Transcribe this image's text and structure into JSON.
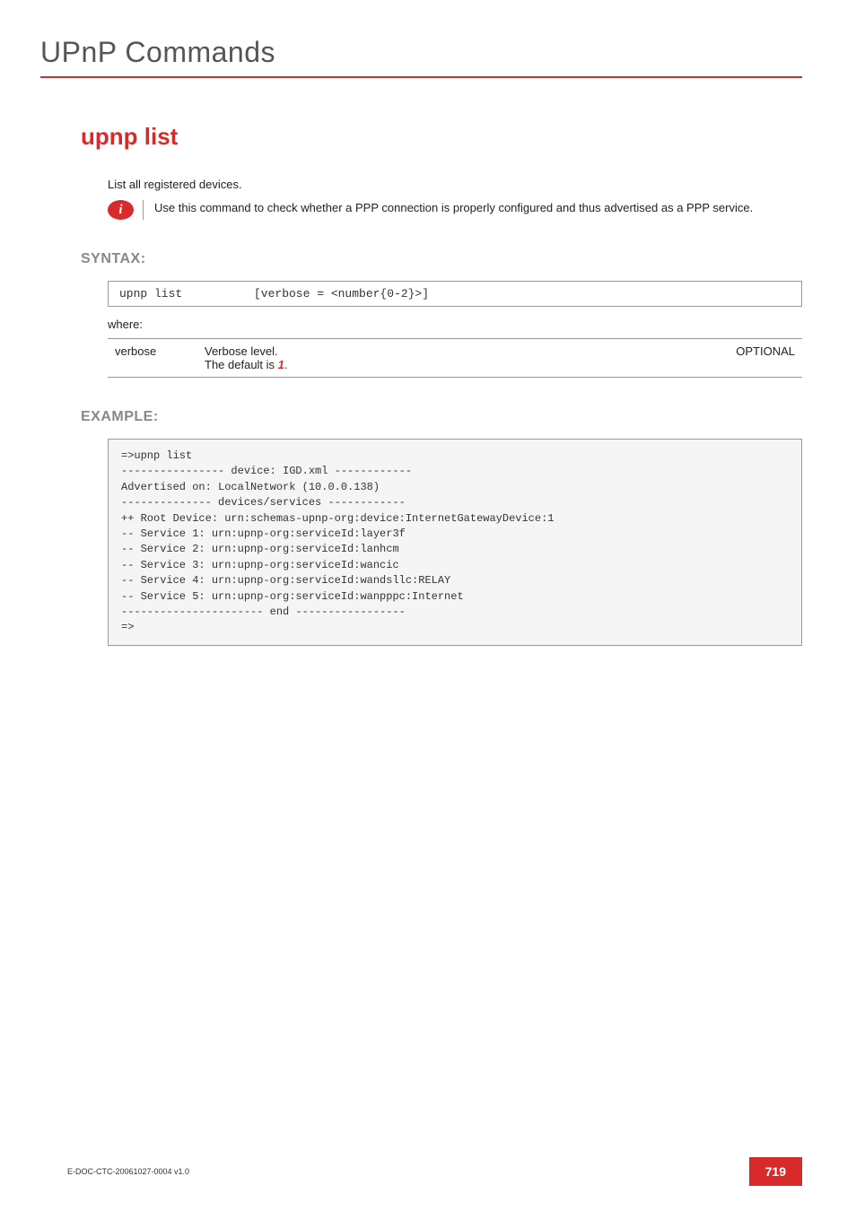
{
  "page": {
    "title": "UPnP Commands",
    "command_title": "upnp list",
    "intro": "List all registered devices.",
    "info_note": "Use this command to check whether a PPP connection is properly configured and thus advertised as a PPP service."
  },
  "syntax": {
    "heading": "SYNTAX:",
    "command": "upnp list",
    "params_str": "[verbose = <number{0-2}>]",
    "where": "where:"
  },
  "param": {
    "name": "verbose",
    "description": "Verbose level.",
    "default_prefix": "The default is ",
    "default_value": "1",
    "default_suffix": ".",
    "optional": "OPTIONAL"
  },
  "example": {
    "heading": "EXAMPLE:",
    "output": "=>upnp list\n---------------- device: IGD.xml ------------\nAdvertised on: LocalNetwork (10.0.0.138)\n-------------- devices/services ------------\n++ Root Device: urn:schemas-upnp-org:device:InternetGatewayDevice:1\n-- Service 1: urn:upnp-org:serviceId:layer3f\n-- Service 2: urn:upnp-org:serviceId:lanhcm\n-- Service 3: urn:upnp-org:serviceId:wancic\n-- Service 4: urn:upnp-org:serviceId:wandsllc:RELAY\n-- Service 5: urn:upnp-org:serviceId:wanpppc:Internet\n---------------------- end -----------------\n=>"
  },
  "footer": {
    "doc_id": "E-DOC-CTC-20061027-0004 v1.0",
    "page_number": "719"
  }
}
